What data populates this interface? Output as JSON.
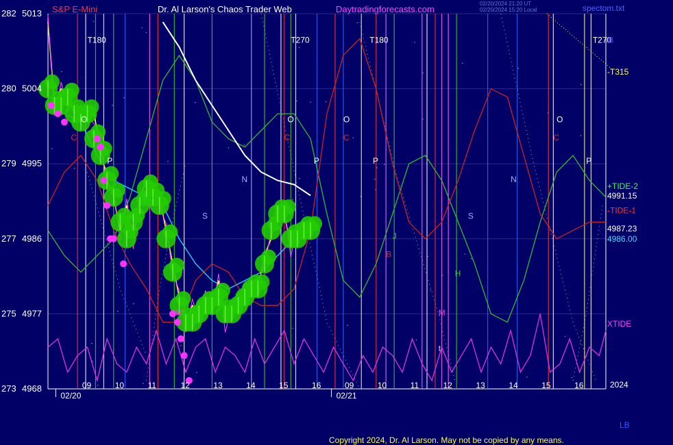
{
  "header": {
    "instrument": "S&P E-Mini",
    "site": "Dr. Al Larson's Chaos Trader Web",
    "url": "Daytradingforecasts.com",
    "stamp_line1": "02/20/2024 21:20 UT",
    "stamp_line2": "02/20/2024 15:20 Local",
    "file": "spectom.txt"
  },
  "footer": {
    "copyright": "Copyright 2024, Dr. Al Larson. May not be copied by any means.",
    "code": "LB",
    "year": "2024"
  },
  "colors": {
    "background": "#000066",
    "price": "#ffff44",
    "fast_avg": "#ff44ff",
    "band": "#22cc00",
    "slow_avg": "#22ddff",
    "long_avg": "#ffffff",
    "tide1": "#dd2222",
    "tide2": "#33bb33",
    "xtide": "#dd33dd",
    "blue_wave": "#2233cc"
  },
  "chart_data": {
    "type": "line",
    "y_left_ticks": [
      {
        "label": "282",
        "price": "5013",
        "v": 5013
      },
      {
        "label": "280",
        "price": "5004",
        "v": 5004
      },
      {
        "label": "279",
        "price": "4995",
        "v": 4995
      },
      {
        "label": "277",
        "price": "4986",
        "v": 4986
      },
      {
        "label": "275",
        "price": "4977",
        "v": 4977
      },
      {
        "label": "273",
        "price": "4968",
        "v": 4968
      }
    ],
    "ylim": [
      4968,
      5013
    ],
    "xlim": [
      0,
      31
    ],
    "hour_ticks": [
      {
        "label": "09",
        "x": 1
      },
      {
        "label": "10",
        "x": 2
      },
      {
        "label": "11",
        "x": 3
      },
      {
        "label": "12",
        "x": 4
      },
      {
        "label": "13",
        "x": 5
      },
      {
        "label": "14",
        "x": 6
      },
      {
        "label": "15",
        "x": 7
      },
      {
        "label": "16",
        "x": 8
      },
      {
        "label": "09",
        "x": 9
      },
      {
        "label": "10",
        "x": 10
      },
      {
        "label": "11",
        "x": 11
      },
      {
        "label": "12",
        "x": 12
      },
      {
        "label": "13",
        "x": 13
      },
      {
        "label": "14",
        "x": 14
      },
      {
        "label": "15",
        "x": 15
      },
      {
        "label": "16",
        "x": 16
      }
    ],
    "date_labels": [
      {
        "label": "02/20",
        "x": 0.3
      },
      {
        "label": "02/21",
        "x": 8.7
      }
    ],
    "right_labels": [
      {
        "text": "+TIDE-2",
        "color": "#44ff44",
        "v": 4992.3
      },
      {
        "text": "4991.15",
        "color": "#ffffff",
        "v": 4991.15
      },
      {
        "text": "-TIDE-1",
        "color": "#ff3333",
        "v": 4989.4
      },
      {
        "text": "4987.23",
        "color": "#ffffff",
        "v": 4987.23
      },
      {
        "text": "4986.00",
        "color": "#44ddff",
        "v": 4986.0
      },
      {
        "text": "XTIDE",
        "color": "#ff44ff",
        "v": 4975.8
      },
      {
        "text": "-T315",
        "color": "#ffff44",
        "v": 5006.0
      }
    ],
    "cycle_markers": [
      {
        "text": "T180",
        "color": "#ffffff",
        "x": 1.2,
        "v": 5009.5
      },
      {
        "text": "T270",
        "color": "#ffffff",
        "x": 7.4,
        "v": 5009.5
      },
      {
        "text": "T180",
        "color": "#ffffff",
        "x": 9.8,
        "v": 5009.5
      },
      {
        "text": "T270",
        "color": "#ffffff",
        "x": 16.6,
        "v": 5009.5
      },
      {
        "text": "IB",
        "color": "#4444ff",
        "x": 17.0,
        "v": 5009.5
      },
      {
        "text": "O",
        "color": "#ffffff",
        "x": 1.0,
        "v": 5000.0
      },
      {
        "text": "O",
        "color": "#ffffff",
        "x": 7.3,
        "v": 5000.0
      },
      {
        "text": "O",
        "color": "#ffffff",
        "x": 9.0,
        "v": 5000.0
      },
      {
        "text": "O",
        "color": "#ffffff",
        "x": 15.5,
        "v": 5000.0
      },
      {
        "text": "C",
        "color": "#cc3333",
        "x": 0.7,
        "v": 4997.8
      },
      {
        "text": "C",
        "color": "#cc3333",
        "x": 7.2,
        "v": 4997.8
      },
      {
        "text": "C",
        "color": "#cc3333",
        "x": 9.0,
        "v": 4997.8
      },
      {
        "text": "C",
        "color": "#cc3333",
        "x": 15.4,
        "v": 4997.8
      },
      {
        "text": "P",
        "color": "#ffffff",
        "x": 1.8,
        "v": 4995.0
      },
      {
        "text": "P",
        "color": "#ffffff",
        "x": 8.1,
        "v": 4995.0
      },
      {
        "text": "P",
        "color": "#ffffff",
        "x": 9.9,
        "v": 4995.0
      },
      {
        "text": "P",
        "color": "#ffffff",
        "x": 16.4,
        "v": 4995.0
      },
      {
        "text": "N",
        "color": "#aaaaff",
        "x": 5.9,
        "v": 4992.8
      },
      {
        "text": "N",
        "color": "#aaaaff",
        "x": 14.1,
        "v": 4992.8
      },
      {
        "text": "S",
        "color": "#aaaaff",
        "x": 4.7,
        "v": 4988.4
      },
      {
        "text": "S",
        "color": "#aaaaff",
        "x": 12.8,
        "v": 4988.4
      },
      {
        "text": "J",
        "color": "#33cc33",
        "x": 10.5,
        "v": 4986.0
      },
      {
        "text": "H",
        "color": "#33cc33",
        "x": 12.4,
        "v": 4981.5
      },
      {
        "text": "B",
        "color": "#cc3333",
        "x": 10.3,
        "v": 4983.8
      },
      {
        "text": "L",
        "color": "#33cc33",
        "x": 2.9,
        "v": 4990.8
      },
      {
        "text": "M",
        "color": "#dd44dd",
        "x": 3.9,
        "v": 4976.8
      },
      {
        "text": "M",
        "color": "#dd44dd",
        "x": 11.9,
        "v": 4976.8
      },
      {
        "text": "t",
        "color": "#cccccc",
        "x": 11.9,
        "v": 4972.5
      }
    ],
    "vlines": [
      {
        "x": 0.9,
        "c": "#ff3333"
      },
      {
        "x": 1.15,
        "c": "#ffffff"
      },
      {
        "x": 1.45,
        "c": "#33cc33"
      },
      {
        "x": 1.7,
        "c": "#ffff66"
      },
      {
        "x": 2.0,
        "c": "#33cc33"
      },
      {
        "x": 2.35,
        "c": "#3366ff"
      },
      {
        "x": 3.1,
        "c": "#ff66ff"
      },
      {
        "x": 3.35,
        "c": "#ff3333"
      },
      {
        "x": 3.85,
        "c": "#33cc33"
      },
      {
        "x": 4.15,
        "c": "#ffffff"
      },
      {
        "x": 5.0,
        "c": "#33cc33"
      },
      {
        "x": 6.2,
        "c": "#aaaaff"
      },
      {
        "x": 6.6,
        "c": "#33cc33"
      },
      {
        "x": 7.1,
        "c": "#ffffff"
      },
      {
        "x": 7.2,
        "c": "#ff3333"
      },
      {
        "x": 7.4,
        "c": "#33cc33"
      },
      {
        "x": 7.55,
        "c": "#ffffff"
      },
      {
        "x": 8.2,
        "c": "#3366ff"
      },
      {
        "x": 8.75,
        "c": "#ff3333"
      },
      {
        "x": 9.0,
        "c": "#3366ff"
      },
      {
        "x": 9.55,
        "c": "#ffff66"
      },
      {
        "x": 10.0,
        "c": "#ff3333"
      },
      {
        "x": 10.3,
        "c": "#ff66ff"
      },
      {
        "x": 10.55,
        "c": "#33cc33"
      },
      {
        "x": 11.4,
        "c": "#ff66ff"
      },
      {
        "x": 11.55,
        "c": "#ffffff"
      },
      {
        "x": 11.8,
        "c": "#ff3333"
      },
      {
        "x": 12.0,
        "c": "#ff66ff"
      },
      {
        "x": 12.2,
        "c": "#ff66ff"
      },
      {
        "x": 12.45,
        "c": "#33cc33"
      },
      {
        "x": 13.4,
        "c": "#3366ff"
      },
      {
        "x": 14.3,
        "c": "#3366ff"
      },
      {
        "x": 15.25,
        "c": "#ff3333"
      },
      {
        "x": 15.4,
        "c": "#ffffff"
      },
      {
        "x": 16.35,
        "c": "#ffff66"
      },
      {
        "x": 16.55,
        "c": "#ffffff"
      }
    ],
    "series": [
      {
        "key": "tide2",
        "color": "#33bb33",
        "x": [
          0,
          0.5,
          1,
          1.5,
          2,
          2.5,
          3,
          3.5,
          4,
          4.5,
          5,
          5.5,
          6,
          6.5,
          7,
          7.5,
          8,
          8.5,
          9,
          9.5,
          10,
          10.5,
          11,
          11.5,
          12,
          12.5,
          13,
          13.5,
          14,
          14.5,
          15,
          15.5,
          16,
          16.5,
          17
        ],
        "y": [
          4987,
          4984,
          4982,
          4984,
          4986,
          4991,
          4998,
          5005,
          5008,
          5005,
          5000,
          4998,
          4997,
          4999,
          5001,
          5001,
          4998,
          4989,
          4981,
          4979,
          4983,
          4989,
          4995,
          4996,
          4993,
          4988,
          4983,
          4977,
          4976,
          4981,
          4988,
          4994,
          4996,
          4993,
          4991
        ]
      },
      {
        "key": "tide1",
        "color": "#cc2222",
        "x": [
          0,
          0.5,
          1,
          1.5,
          2,
          2.5,
          3,
          3.5,
          4,
          4.5,
          5,
          5.5,
          6,
          6.5,
          7,
          7.5,
          8,
          8.5,
          9,
          9.5,
          10,
          10.5,
          11,
          11.5,
          12,
          12.5,
          13,
          13.5,
          14,
          14.5,
          15,
          15.5,
          16,
          16.5,
          17
        ],
        "y": [
          4990,
          4994,
          4996,
          4993,
          4987,
          4983,
          4980,
          4976,
          4976,
          4981,
          4983,
          4982,
          4979,
          4978,
          4978,
          4980,
          4987,
          5001,
          5008,
          5010,
          5004,
          4995,
          4988,
          4986,
          4988,
          4993,
          4999,
          5004,
          5003,
          4996,
          4989,
          4986,
          4987,
          4988,
          4988
        ]
      },
      {
        "key": "xtide",
        "color": "#dd33dd",
        "x": [
          0,
          0.3,
          0.6,
          0.9,
          1.2,
          1.5,
          1.8,
          2.1,
          2.4,
          2.7,
          3.0,
          3.3,
          3.6,
          3.9,
          4.2,
          4.5,
          4.8,
          5.1,
          5.4,
          5.7,
          6.0,
          6.3,
          6.6,
          6.9,
          7.2,
          7.5,
          7.8,
          8.1,
          8.4,
          8.7,
          9.0,
          9.3,
          9.6,
          9.9,
          10.2,
          10.5,
          10.8,
          11.1,
          11.4,
          11.7,
          12.0,
          12.3,
          12.6,
          12.9,
          13.2,
          13.5,
          13.8,
          14.1,
          14.4,
          14.7,
          15.0,
          15.3,
          15.6,
          15.9,
          16.2,
          16.5,
          16.8,
          17
        ],
        "y": [
          4973,
          4974,
          4970,
          4972,
          4973,
          4969,
          4974,
          4971,
          4970,
          4973,
          4971,
          4975,
          4971,
          4974,
          4970,
          4973,
          4974,
          4970,
          4973,
          4972,
          4970,
          4974,
          4971,
          4973,
          4975,
          4971,
          4974,
          4972,
          4970,
          4973,
          4971,
          4969,
          4972,
          4970,
          4973,
          4972,
          4970,
          4974,
          4971,
          4969,
          4973,
          4970,
          4972,
          4974,
          4970,
          4973,
          4971,
          4975,
          4970,
          4972,
          4977,
          4970,
          4971,
          4974,
          4970,
          4973,
          4972,
          4975
        ]
      },
      {
        "key": "slow",
        "color": "#22ddff",
        "x": [
          0,
          0.5,
          1,
          1.5,
          2,
          2.5,
          3,
          3.5,
          4,
          4.5,
          5,
          5.5,
          6,
          6.5,
          7,
          7.5,
          8
        ],
        "y": [
          5002,
          5001,
          5000,
          4996,
          4993,
          4992,
          4991,
          4990,
          4986,
          4983,
          4981,
          4980,
          4981,
          4982,
          4984,
          4986,
          4986
        ]
      },
      {
        "key": "long",
        "color": "#ffffff",
        "x": [
          3.5,
          4,
          4.5,
          5,
          5.5,
          6,
          6.5,
          7,
          7.5,
          8
        ],
        "y": [
          5012,
          5009,
          5005,
          5002,
          4999,
          4996,
          4994,
          4993,
          4992.5,
          4991.2
        ]
      },
      {
        "key": "price",
        "color": "#ffff44",
        "x": [
          0,
          0.2,
          0.4,
          0.6,
          0.8,
          1.0,
          1.2,
          1.4,
          1.6,
          1.8,
          2.0,
          2.2,
          2.4,
          2.6,
          2.8,
          3.0,
          3.2,
          3.4,
          3.6,
          3.8,
          4.0,
          4.2,
          4.4,
          4.6,
          4.8,
          5.0,
          5.2,
          5.4,
          5.6,
          5.8,
          6.0,
          6.2,
          6.4,
          6.6,
          6.8,
          7.0,
          7.2,
          7.4,
          7.6,
          7.8,
          8.0
        ],
        "y": [
          5012,
          5002,
          5004,
          5003,
          5001,
          5002,
          5000,
          5001,
          4997,
          4993,
          4991,
          4987,
          4990,
          4986,
          4991,
          4993,
          4992,
          4991,
          4987,
          4983,
          4979,
          4976,
          4978,
          4977,
          4979,
          4978,
          4981,
          4976,
          4977,
          4979,
          4980,
          4981,
          4980,
          4984,
          4986,
          4990,
          4989,
          4985,
          4987,
          4988,
          4987
        ]
      }
    ],
    "band_y": [
      5004,
      5002,
      5002,
      5003,
      5001,
      5000,
      5001,
      4998,
      4996,
      4993,
      4991,
      4988,
      4986,
      4988,
      4990,
      4992,
      4991,
      4990,
      4986,
      4982,
      4978,
      4976,
      4976,
      4977,
      4978,
      4978,
      4979,
      4977,
      4977,
      4978,
      4979,
      4980,
      4980,
      4983,
      4987,
      4989,
      4989,
      4986,
      4986,
      4987,
      4987
    ],
    "dots": [
      {
        "x": 0.1,
        "v": 5002
      },
      {
        "x": 0.3,
        "v": 5001
      },
      {
        "x": 0.5,
        "v": 5000
      },
      {
        "x": 1.5,
        "v": 4998
      },
      {
        "x": 1.6,
        "v": 4997
      },
      {
        "x": 1.7,
        "v": 4993
      },
      {
        "x": 1.8,
        "v": 4990
      },
      {
        "x": 1.9,
        "v": 4986
      },
      {
        "x": 2.0,
        "v": 4986
      },
      {
        "x": 2.3,
        "v": 4983
      },
      {
        "x": 3.8,
        "v": 4977
      },
      {
        "x": 3.95,
        "v": 4976
      },
      {
        "x": 4.05,
        "v": 4974
      },
      {
        "x": 4.15,
        "v": 4972
      },
      {
        "x": 4.3,
        "v": 4969
      }
    ]
  }
}
